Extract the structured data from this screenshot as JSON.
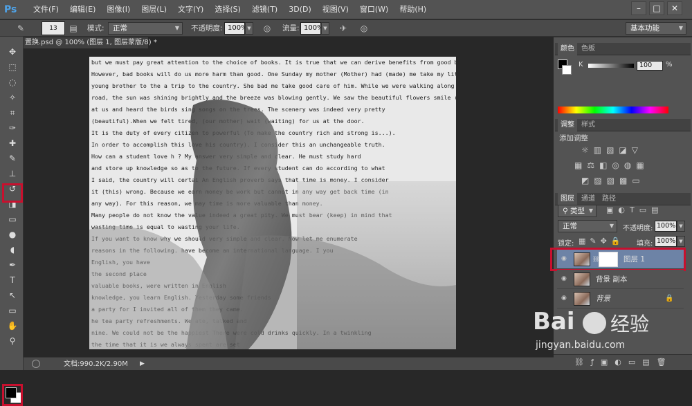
{
  "app": {
    "logo": "Ps",
    "menus": [
      "文件(F)",
      "编辑(E)",
      "图像(I)",
      "图层(L)",
      "文字(Y)",
      "选择(S)",
      "滤镜(T)",
      "3D(D)",
      "视图(V)",
      "窗口(W)",
      "帮助(H)"
    ],
    "window_controls": [
      "–",
      "□",
      "✕"
    ]
  },
  "options": {
    "brush_size": "13",
    "mode_label": "模式:",
    "mode_value": "正常",
    "opacity_label": "不透明度:",
    "opacity_value": "100%",
    "flow_label": "流量:",
    "flow_value": "100%",
    "workspace": "基本功能"
  },
  "document": {
    "tab_title": "置换.psd @ 100% (图层 1, 图层蒙版/8) *",
    "status": "文档:990.2K/2.90M",
    "text_lines": [
      "but we must pay great attention to the choice of books. It is true that we can derive benefits from good books.",
      "However, bad books will do us more harm than good. One Sunday my mother (Mother) had (made) me take my little",
      "young brother to the  a trip to the country. She bad me take good care of him. While we were walking along the",
      "road, the sun was shining brightly and the breeze was blowing gently. We saw the beautiful flowers smile (smiling)",
      "at us and heard the birds sing        songs on the trees. The scenery was indeed very pretty",
      "(beautiful).When we felt tired,        (our mother) wait (waiting) for us at the door.",
      "It is the duty of every citizen to        powerful (To make the country rich and strong is...).",
      "In order to accomplish this          love his country). I consider this an unchangeable truth.",
      "How can a student love h           ? My answer very simple and clear. He must study hard",
      "and store up knowledge so as to      the future. If every student can do according to what",
      "I said, the country will certai     An English proverb says that time is money. I consider",
      "it (this) wrong. Because we         earn money be work but cannot in any way get back time (in",
      "any way). For this reason, we may   time is more valuable than money.",
      "Many people do not know the value   indeed a great pity. We must bear (keep) in mind that",
      "wasting time is equal to wasting your life.",
      "If you want to know why we should    very simple and clear. Now let me enumerate",
      "reasons in the following.          have become an international language. I you",
      "   English, you have            ",
      "   the second place         ",
      "   valuable books,           were written in English",
      "   knowledge, you       learn English. Yesterday    some friends",
      "   a party for        I invited all of them     they came.",
      "   he tea party           refreshments. We ate, talked and",
      "   nine. We could not be the happiest      There were cold drinks quickly. In a twinkling",
      "   the time that            it is we always spent      are set"
    ]
  },
  "panels": {
    "color_tabs": [
      "颜色",
      "色板"
    ],
    "color_k_label": "K",
    "color_k_value": "100",
    "color_percent": "%",
    "adjust_tabs": [
      "调整",
      "样式"
    ],
    "adjust_title": "添加调整",
    "layer_tabs": [
      "图层",
      "通道",
      "路径"
    ],
    "filter_kind": "类型",
    "blend_mode": "正常",
    "opacity_label": "不透明度:",
    "opacity_value": "100%",
    "lock_label": "锁定:",
    "fill_label": "填充:",
    "fill_value": "100%",
    "layers": [
      {
        "name": "图层 1",
        "selected": true
      },
      {
        "name": "背景 副本",
        "selected": false
      },
      {
        "name": "背景",
        "selected": false
      }
    ]
  },
  "watermark": {
    "brand": "Bai",
    "brand_cn": "经验",
    "url": "jingyan.baidu.com"
  },
  "colors": {
    "highlight_red": "#c8102e",
    "selected_layer": "#6d83a6"
  }
}
